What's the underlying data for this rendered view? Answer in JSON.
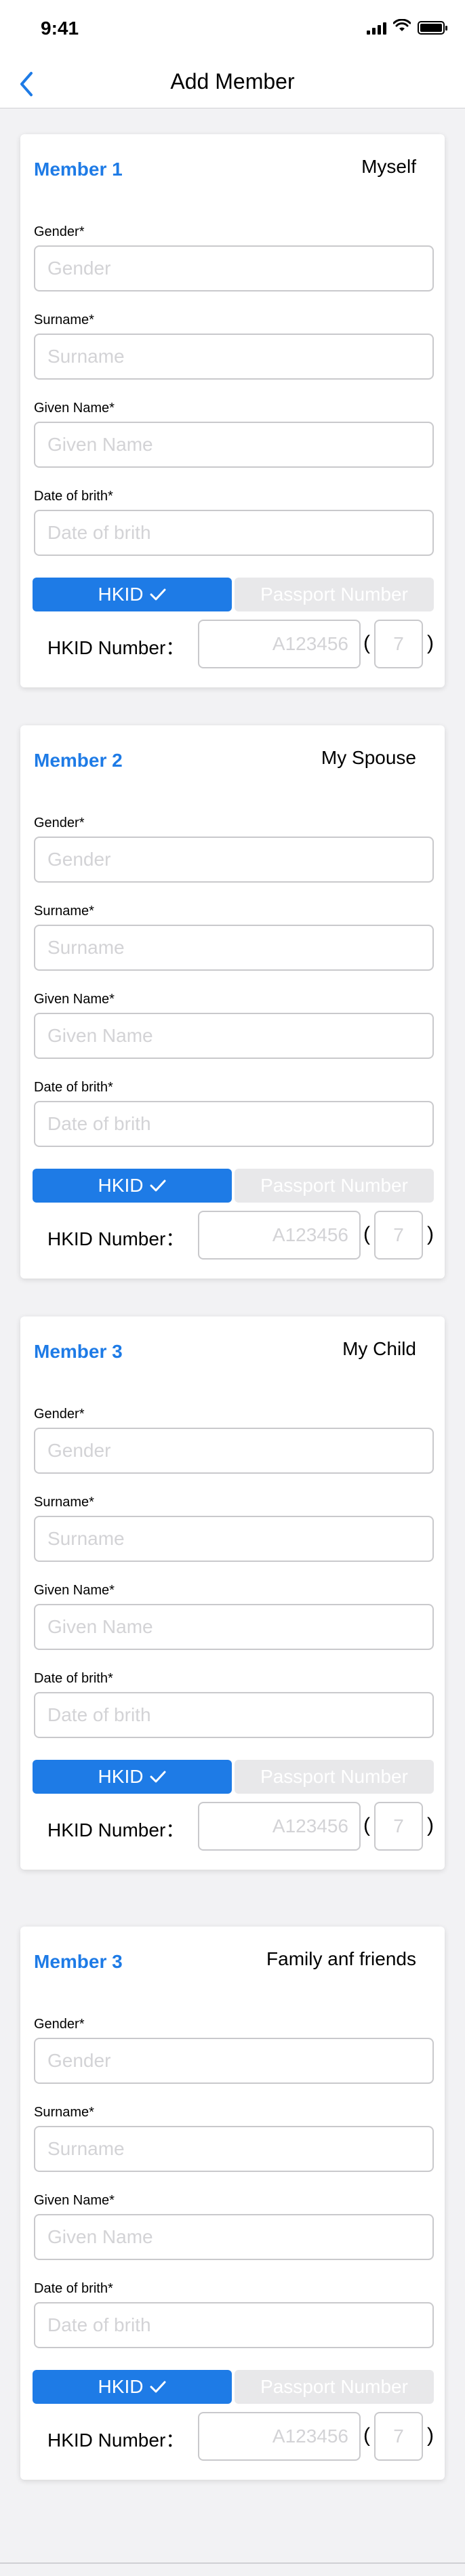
{
  "status_bar": {
    "time": "9:41",
    "icons": [
      "signal-icon",
      "wifi-icon",
      "battery-icon"
    ]
  },
  "nav": {
    "back_icon": "chevron-left-icon",
    "title": "Add Member"
  },
  "colors": {
    "accent": "#1e7be6",
    "toggle_inactive": "#e8e8ea",
    "card_bg": "#ffffff",
    "page_bg": "#f2f2f4"
  },
  "members": [
    {
      "number_label": "Member 1",
      "relation": "Myself",
      "fields": [
        {
          "label": "Gender*",
          "placeholder": "Gender",
          "value": ""
        },
        {
          "label": "Surname*",
          "placeholder": "Surname",
          "value": ""
        },
        {
          "label": "Given Name*",
          "placeholder": "Given Name",
          "value": ""
        },
        {
          "label": "Date of brith*",
          "placeholder": "Date of brith",
          "value": ""
        }
      ],
      "id_toggle": {
        "hkid_label": "HKID",
        "passport_label": "Passport Number",
        "selected": "HKID"
      },
      "hkid_number": {
        "label": "HKID Number：",
        "placeholder": "A123456",
        "check_placeholder": "7",
        "paren_open": "(",
        "paren_close": ")"
      }
    },
    {
      "number_label": "Member 2",
      "relation": "My Spouse",
      "fields": [
        {
          "label": "Gender*",
          "placeholder": "Gender",
          "value": ""
        },
        {
          "label": "Surname*",
          "placeholder": "Surname",
          "value": ""
        },
        {
          "label": "Given Name*",
          "placeholder": "Given Name",
          "value": ""
        },
        {
          "label": "Date of brith*",
          "placeholder": "Date of brith",
          "value": ""
        }
      ],
      "id_toggle": {
        "hkid_label": "HKID",
        "passport_label": "Passport Number",
        "selected": "HKID"
      },
      "hkid_number": {
        "label": "HKID Number：",
        "placeholder": "A123456",
        "check_placeholder": "7",
        "paren_open": "(",
        "paren_close": ")"
      }
    },
    {
      "number_label": "Member 3",
      "relation": "My Child",
      "fields": [
        {
          "label": "Gender*",
          "placeholder": "Gender",
          "value": ""
        },
        {
          "label": "Surname*",
          "placeholder": "Surname",
          "value": ""
        },
        {
          "label": "Given Name*",
          "placeholder": "Given Name",
          "value": ""
        },
        {
          "label": "Date of brith*",
          "placeholder": "Date of brith",
          "value": ""
        }
      ],
      "id_toggle": {
        "hkid_label": "HKID",
        "passport_label": "Passport Number",
        "selected": "HKID"
      },
      "hkid_number": {
        "label": "HKID Number：",
        "placeholder": "A123456",
        "check_placeholder": "7",
        "paren_open": "(",
        "paren_close": ")"
      }
    },
    {
      "number_label": "Member 3",
      "relation": "Family anf friends",
      "fields": [
        {
          "label": "Gender*",
          "placeholder": "Gender",
          "value": ""
        },
        {
          "label": "Surname*",
          "placeholder": "Surname",
          "value": ""
        },
        {
          "label": "Given Name*",
          "placeholder": "Given Name",
          "value": ""
        },
        {
          "label": "Date of brith*",
          "placeholder": "Date of brith",
          "value": ""
        }
      ],
      "id_toggle": {
        "hkid_label": "HKID",
        "passport_label": "Passport Number",
        "selected": "HKID"
      },
      "hkid_number": {
        "label": "HKID Number：",
        "placeholder": "A123456",
        "check_placeholder": "7",
        "paren_open": "(",
        "paren_close": ")"
      }
    }
  ]
}
